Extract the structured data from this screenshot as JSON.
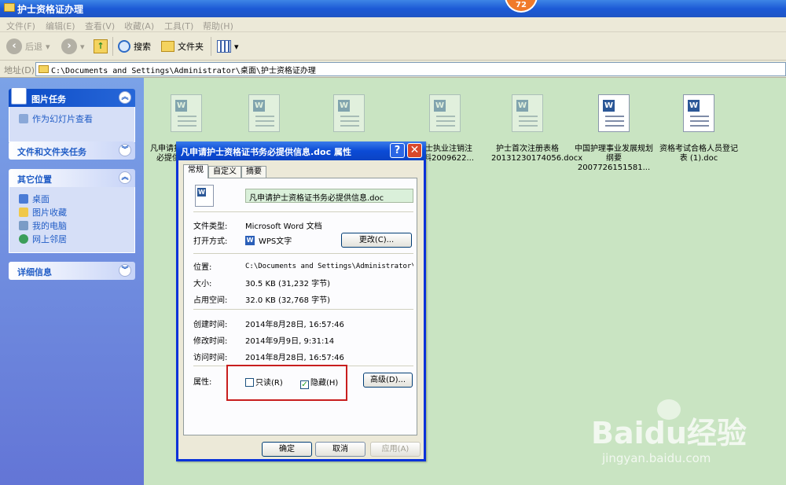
{
  "window": {
    "title": "护士资格证办理",
    "badge": "72"
  },
  "menu": [
    "文件(F)",
    "编辑(E)",
    "查看(V)",
    "收藏(A)",
    "工具(T)",
    "帮助(H)"
  ],
  "toolbar": {
    "back": "后退",
    "search": "搜索",
    "folders": "文件夹"
  },
  "address": {
    "label": "地址(D)",
    "path": "C:\\Documents and Settings\\Administrator\\桌面\\护士资格证办理"
  },
  "sidebar": {
    "picture_tasks": {
      "title": "图片任务",
      "items": [
        "作为幻灯片查看"
      ]
    },
    "file_tasks": {
      "title": "文件和文件夹任务"
    },
    "other_places": {
      "title": "其它位置",
      "items": [
        "桌面",
        "图片收藏",
        "我的电脑",
        "网上邻居"
      ]
    },
    "details": {
      "title": "详细信息"
    }
  },
  "files": [
    {
      "line1": "凡申请护",
      "line2": "必提供"
    },
    {
      "line1": "",
      "line2": ""
    },
    {
      "line1": "",
      "line2": ""
    },
    {
      "line1": "护士执业注销注",
      "line2": "材料2009622..."
    },
    {
      "line1": "护士首次注册表格",
      "line2": "20131230174056.docx"
    },
    {
      "line1": "中国护理事业发展规划",
      "line2": "纲要2007726151581..."
    },
    {
      "line1": "资格考试合格人员登记",
      "line2": "表 (1).doc"
    }
  ],
  "dialog": {
    "title": "凡申请护士资格证书务必提供信息.doc 属性",
    "tabs": [
      "常规",
      "自定义",
      "摘要"
    ],
    "filename": "凡申请护士资格证书务必提供信息.doc",
    "type_label": "文件类型:",
    "type_value": "Microsoft Word 文档",
    "open_label": "打开方式:",
    "open_value": "WPS文字",
    "change_btn": "更改(C)...",
    "location_label": "位置:",
    "location_value": "C:\\Documents and Settings\\Administrator\\桌",
    "size_label": "大小:",
    "size_value": "30.5 KB (31,232 字节)",
    "disk_label": "占用空间:",
    "disk_value": "32.0 KB (32,768 字节)",
    "created_label": "创建时间:",
    "created_value": "2014年8月28日, 16:57:46",
    "modified_label": "修改时间:",
    "modified_value": "2014年9月9日, 9:31:14",
    "accessed_label": "访问时间:",
    "accessed_value": "2014年8月28日, 16:57:46",
    "attr_label": "属性:",
    "readonly": "只读(R)",
    "hidden": "隐藏(H)",
    "hidden_checked": true,
    "advanced_btn": "高级(D)...",
    "ok": "确定",
    "cancel": "取消",
    "apply": "应用(A)"
  },
  "watermark": {
    "brand": "Baidu经验",
    "url": "jingyan.baidu.com"
  }
}
